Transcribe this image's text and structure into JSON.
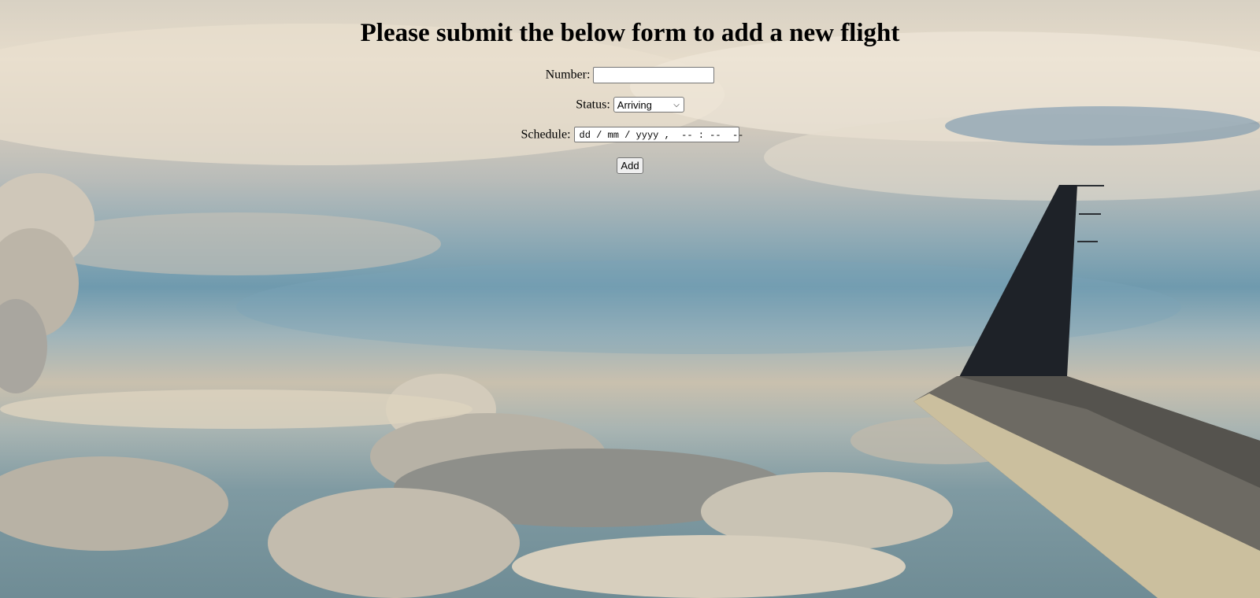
{
  "form": {
    "title": "Please submit the below form to add a new flight",
    "number_label": "Number:",
    "number_value": "",
    "status_label": "Status:",
    "status_selected": "Arriving",
    "schedule_label": "Schedule:",
    "schedule_placeholder": "dd / mm / yyyy ,  -- : --  --",
    "add_label": "Add"
  },
  "background": {
    "scene": "sky-with-clouds-and-airplane-wing"
  },
  "icons": {
    "select_chevron": "chevron-down-icon"
  }
}
